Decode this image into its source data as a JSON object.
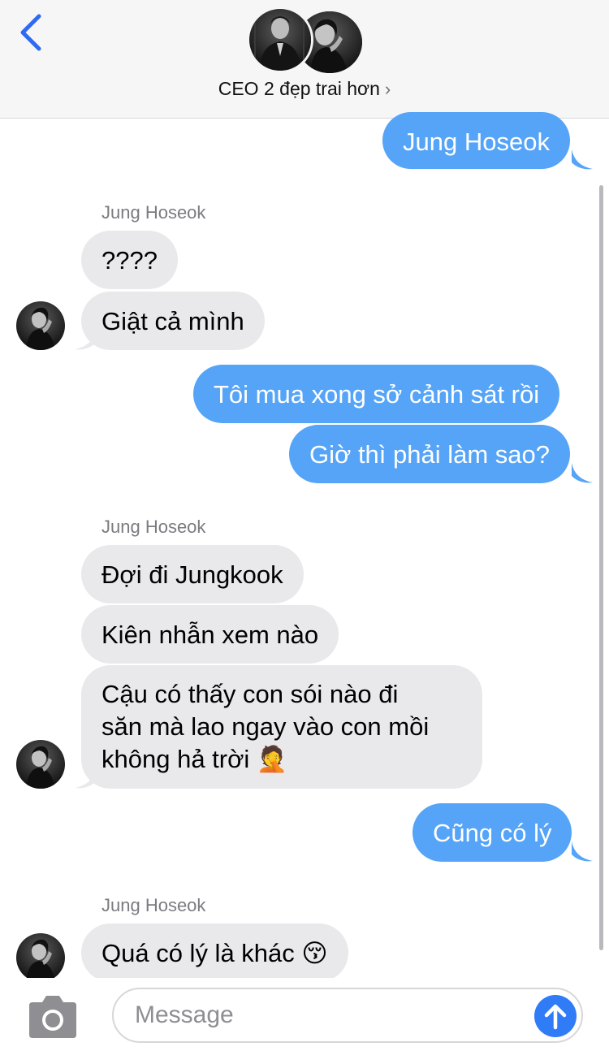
{
  "header": {
    "title": "CEO 2 đẹp trai hơn",
    "chevron": "›",
    "accent": "#2f6bef"
  },
  "conversation": {
    "messages": [
      {
        "direction": "out",
        "text": "Jung Hoseok"
      },
      {
        "direction": "in",
        "sender": "Jung Hoseok",
        "text": "????"
      },
      {
        "direction": "in",
        "text": "Giật cả mình"
      },
      {
        "direction": "out",
        "text": "Tôi mua xong sở cảnh sát rồi"
      },
      {
        "direction": "out",
        "text": "Giờ thì phải làm sao?"
      },
      {
        "direction": "in",
        "sender": "Jung Hoseok",
        "text": "Đợi đi Jungkook"
      },
      {
        "direction": "in",
        "text": "Kiên nhẫn xem nào"
      },
      {
        "direction": "in",
        "lines": [
          "Cậu có thấy con sói nào đi",
          "săn mà lao ngay vào con mồi",
          "không hả trời 🤦"
        ]
      },
      {
        "direction": "out",
        "text": "Cũng có lý"
      },
      {
        "direction": "in",
        "sender": "Jung Hoseok",
        "text": "Quá có lý là khác 😚"
      }
    ]
  },
  "composer": {
    "placeholder": "Message",
    "camera_icon": "camera-icon",
    "send_icon": "send-arrow-up-icon"
  },
  "colors": {
    "outgoing_bubble": "#55a4f7",
    "incoming_bubble": "#e9e9eb",
    "send_button": "#2f7cf6"
  }
}
